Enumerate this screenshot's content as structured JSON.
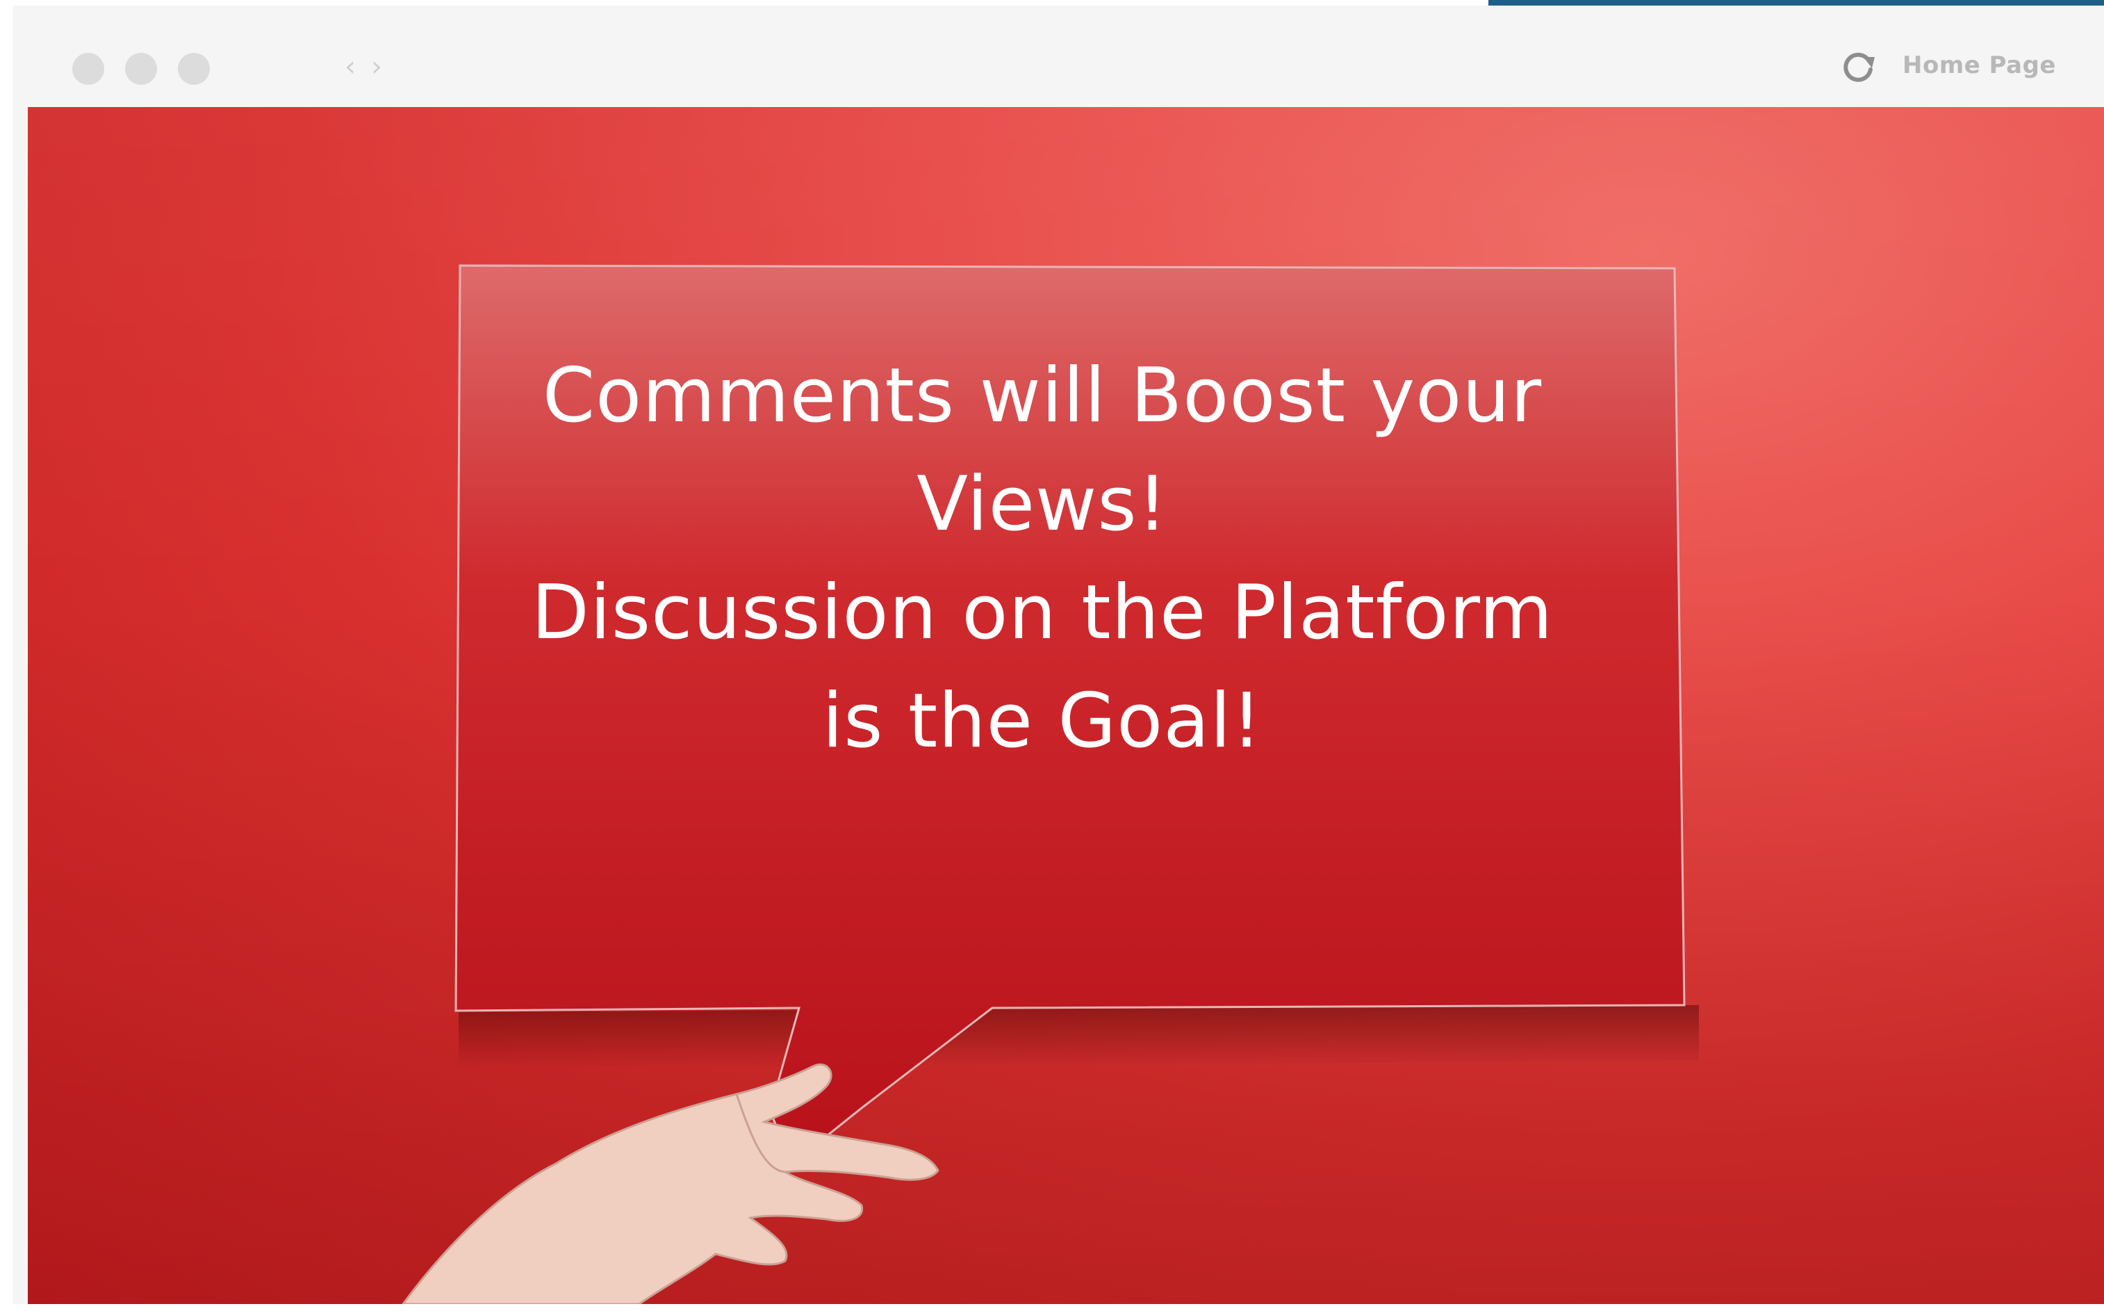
{
  "browser": {
    "traffic_lights": [
      "close",
      "minimize",
      "maximize"
    ],
    "nav": {
      "back_icon": "chevron-left-icon",
      "forward_icon": "chevron-right-icon",
      "back_glyph": "‹",
      "forward_glyph": "›"
    },
    "reload_icon": "reload-icon",
    "home_label": "Home Page"
  },
  "hero": {
    "background_color": "#e0403d",
    "bubble_color": "#c3161c",
    "lines": [
      "Comments will Boost your",
      "Views!",
      "Discussion on the Platform",
      "is the Goal!"
    ]
  },
  "colors": {
    "accent_strip": "#1f5f8b",
    "toolbar": "#f5f5f5",
    "traffic_light": "#dcdcdc",
    "home_label": "#b8b8b8"
  }
}
